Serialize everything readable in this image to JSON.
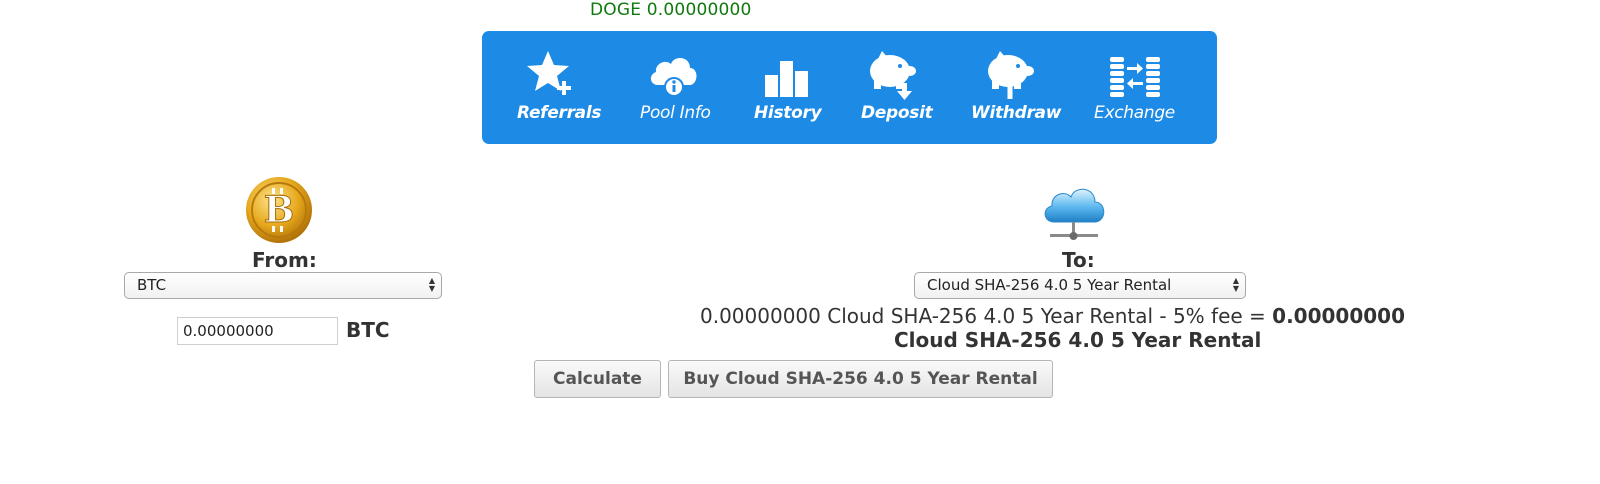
{
  "balance": {
    "text": "DOGE 0.00000000"
  },
  "nav": {
    "color": "#1d8be6",
    "items": [
      {
        "label": "Referrals",
        "icon": "star-plus-icon"
      },
      {
        "label": "Pool Info",
        "icon": "cloud-info-icon"
      },
      {
        "label": "History",
        "icon": "bar-chart-icon"
      },
      {
        "label": "Deposit",
        "icon": "piggy-deposit-icon"
      },
      {
        "label": "Withdraw",
        "icon": "piggy-withdraw-icon"
      },
      {
        "label": "Exchange",
        "icon": "coins-exchange-icon"
      }
    ]
  },
  "from": {
    "label": "From:",
    "selected": "BTC",
    "amount": "0.00000000",
    "unit": "BTC"
  },
  "to": {
    "label": "To:",
    "selected": "Cloud SHA-256 4.0 5 Year Rental"
  },
  "result": {
    "prefix": "0.00000000 Cloud SHA-256 4.0 5 Year Rental - 5% fee = ",
    "value": "0.00000000",
    "suffix": "Cloud SHA-256 4.0 5 Year Rental"
  },
  "buttons": {
    "calculate": "Calculate",
    "buy": "Buy Cloud SHA-256 4.0 5 Year Rental"
  }
}
